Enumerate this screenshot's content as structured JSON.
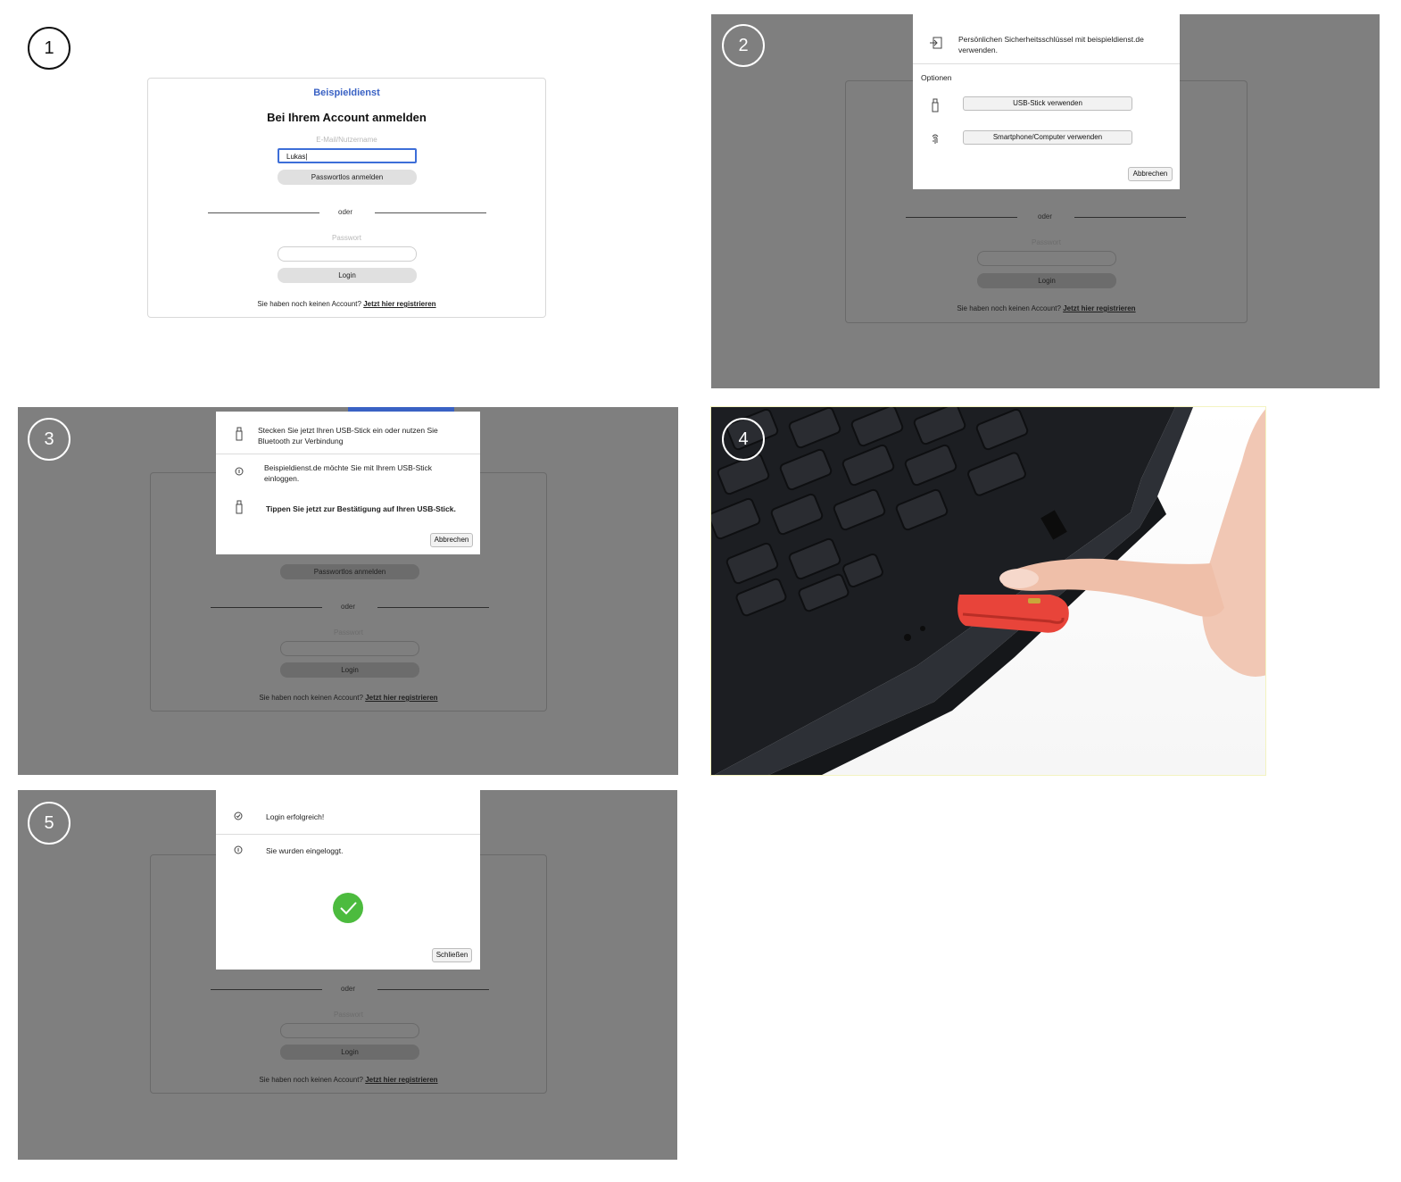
{
  "steps": [
    "1",
    "2",
    "3",
    "4",
    "5"
  ],
  "login": {
    "brand": "Beispieldienst",
    "heading": "Bei Ihrem Account anmelden",
    "email_label": "E-Mail/Nutzername",
    "email_value": "Lukas|",
    "passwordless_button": "Passwortlos anmelden",
    "or_text": "oder",
    "password_label": "Passwort",
    "login_button": "Login",
    "register_prompt": "Sie haben noch keinen Account?",
    "register_link": "Jetzt hier registrieren"
  },
  "dialog_security_key": {
    "title": "Persönlichen Sicherheitsschlüssel mit beispieldienst.de verwenden.",
    "options_label": "Optionen",
    "usb_button": "USB-Stick verwenden",
    "phone_button": "Smartphone/Computer verwenden",
    "cancel_button": "Abbrechen"
  },
  "dialog_usb": {
    "insert_text": "Stecken Sie jetzt Ihren USB-Stick ein oder nutzen Sie Bluetooth zur Verbindung",
    "info_text": "Beispieldienst.de möchte Sie mit Ihrem USB-Stick einloggen.",
    "tap_text": "Tippen Sie jetzt zur Bestätigung auf Ihren USB-Stick.",
    "cancel_button": "Abbrechen"
  },
  "dialog_success": {
    "title": "Login erfolgreich!",
    "info_text": "Sie wurden eingeloggt.",
    "close_button": "Schließen"
  },
  "colors": {
    "brand_blue": "#3a62c4",
    "overlay_gray": "#7f7f7f",
    "success_green": "#4cbb3e",
    "key_red": "#e8443a"
  }
}
